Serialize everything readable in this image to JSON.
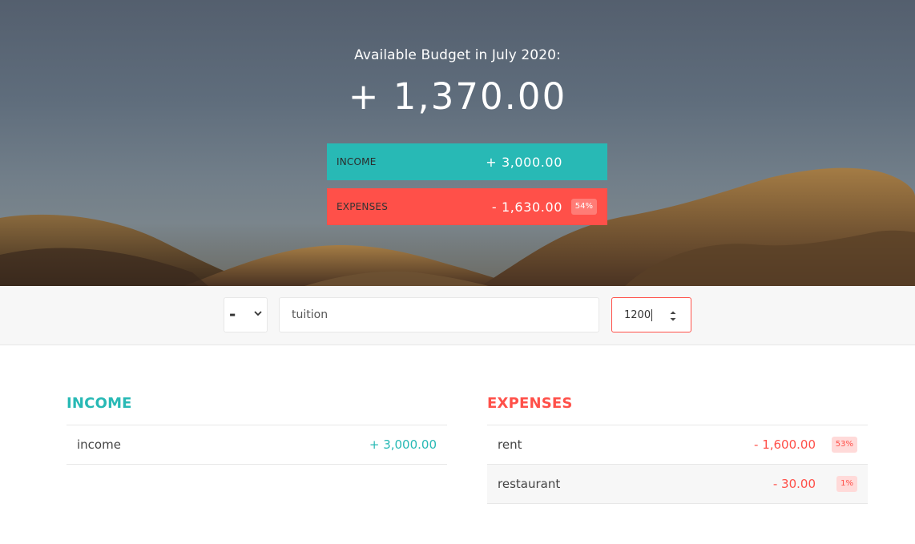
{
  "header": {
    "title": "Available Budget in July 2020:",
    "budget_value": "+ 1,370.00",
    "income": {
      "label": "INCOME",
      "amount": "+ 3,000.00"
    },
    "expenses": {
      "label": "EXPENSES",
      "amount": "- 1,630.00",
      "percentage": "54%"
    }
  },
  "add_form": {
    "type_value": "-",
    "description_value": "tuition",
    "amount_value": "1200"
  },
  "income": {
    "title": "Income",
    "items": [
      {
        "description": "income",
        "value": "+ 3,000.00"
      }
    ]
  },
  "expenses": {
    "title": "Expenses",
    "items": [
      {
        "description": "rent",
        "value": "- 1,600.00",
        "percentage": "53%"
      },
      {
        "description": "restaurant",
        "value": "- 30.00",
        "percentage": "1%"
      }
    ]
  },
  "colors": {
    "income": "#28b9b5",
    "expense": "#ff5049",
    "expense_badge_bg": "#ffdad9"
  },
  "icons": [
    "chevron-down-icon",
    "spinner-arrows-icon"
  ]
}
